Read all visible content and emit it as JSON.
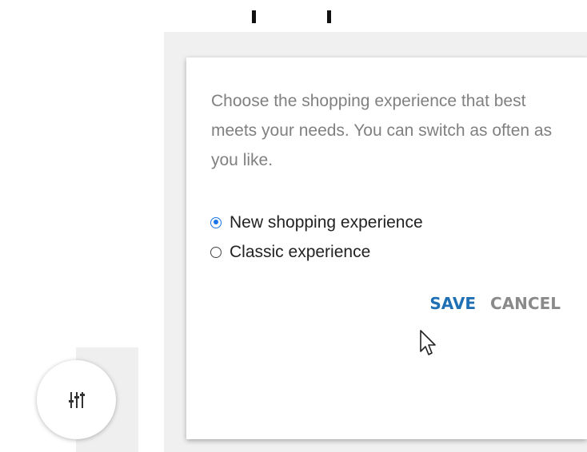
{
  "dialog": {
    "description": "Choose the shopping experience that best meets your needs. You can switch as often as you like.",
    "options": [
      {
        "label": "New shopping experience",
        "selected": true
      },
      {
        "label": "Classic experience",
        "selected": false
      }
    ],
    "save_label": "SAVE",
    "cancel_label": "CANCEL"
  },
  "fab": {
    "icon": "sliders-icon"
  },
  "colors": {
    "accent": "#1a73e8",
    "save": "#1f6fb5",
    "cancel": "#8a8a8a",
    "description": "#808080",
    "panel_bg": "#f0f0f0"
  }
}
